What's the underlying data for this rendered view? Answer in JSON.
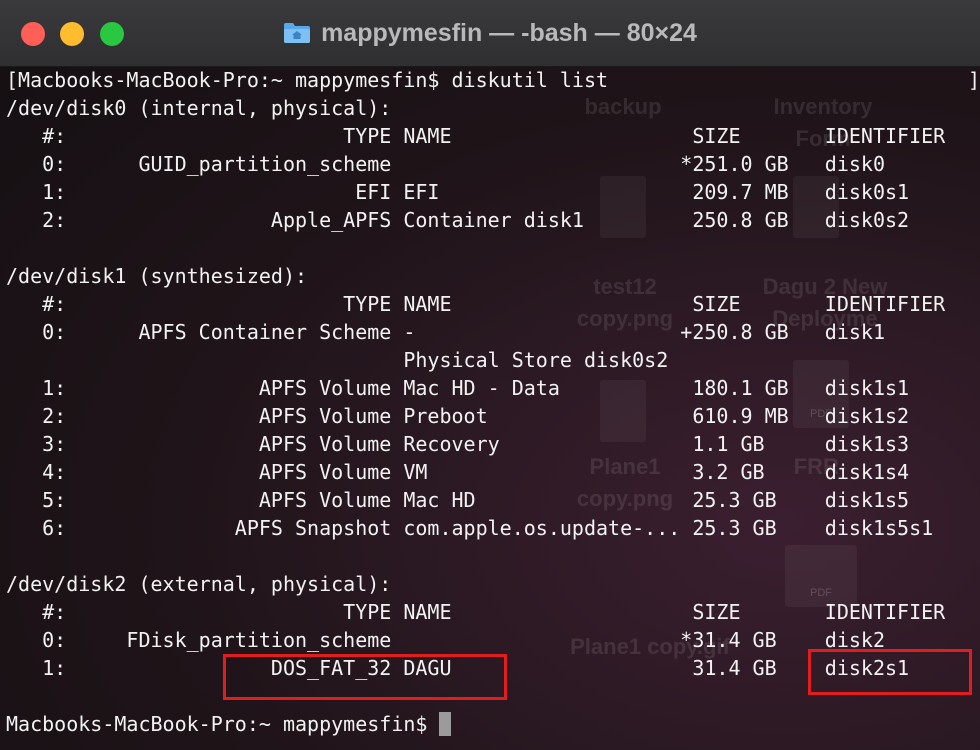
{
  "window": {
    "title": "mappymesfin — -bash — 80×24"
  },
  "desktop_ghosts": [
    {
      "text": "backup"
    },
    {
      "text": "Inventory"
    },
    {
      "text": "Form"
    },
    {
      "text": "test12"
    },
    {
      "text": "copy.png"
    },
    {
      "text": "Dagu 2 New"
    },
    {
      "text": "Deployme"
    },
    {
      "text": "Plane1"
    },
    {
      "text": "copy.png"
    },
    {
      "text": "FRR-"
    },
    {
      "text": "Plane1 copy.gif"
    },
    {
      "text": "PDF"
    },
    {
      "text": "PDF"
    }
  ],
  "terminal": {
    "command_prompt": "[Macbooks-MacBook-Pro:~ mappymesfin$ diskutil list",
    "final_prompt": "Macbooks-MacBook-Pro:~ mappymesfin$ ",
    "right_bracket": "]",
    "lines": [
      "/dev/disk0 (internal, physical):",
      "   #:                       TYPE NAME                    SIZE       IDENTIFIER",
      "   0:      GUID_partition_scheme                        *251.0 GB   disk0",
      "   1:                        EFI EFI                     209.7 MB   disk0s1",
      "   2:                 Apple_APFS Container disk1         250.8 GB   disk0s2",
      "",
      "/dev/disk1 (synthesized):",
      "   #:                       TYPE NAME                    SIZE       IDENTIFIER",
      "   0:      APFS Container Scheme -                      +250.8 GB   disk1",
      "                                 Physical Store disk0s2",
      "   1:                APFS Volume Mac HD - Data           180.1 GB   disk1s1",
      "   2:                APFS Volume Preboot                 610.9 MB   disk1s2",
      "   3:                APFS Volume Recovery                1.1 GB     disk1s3",
      "   4:                APFS Volume VM                      3.2 GB     disk1s4",
      "   5:                APFS Volume Mac HD                  25.3 GB    disk1s5",
      "   6:              APFS Snapshot com.apple.os.update-... 25.3 GB    disk1s5s1",
      "",
      "/dev/disk2 (external, physical):",
      "   #:                       TYPE NAME                    SIZE       IDENTIFIER",
      "   0:     FDisk_partition_scheme                        *31.4 GB    disk2",
      "   1:                 DOS_FAT_32 DAGU                    31.4 GB    disk2s1",
      ""
    ]
  },
  "colors": {
    "highlight": "#e11d1d",
    "text": "#f2f2f2",
    "titlebar": "#333335"
  }
}
